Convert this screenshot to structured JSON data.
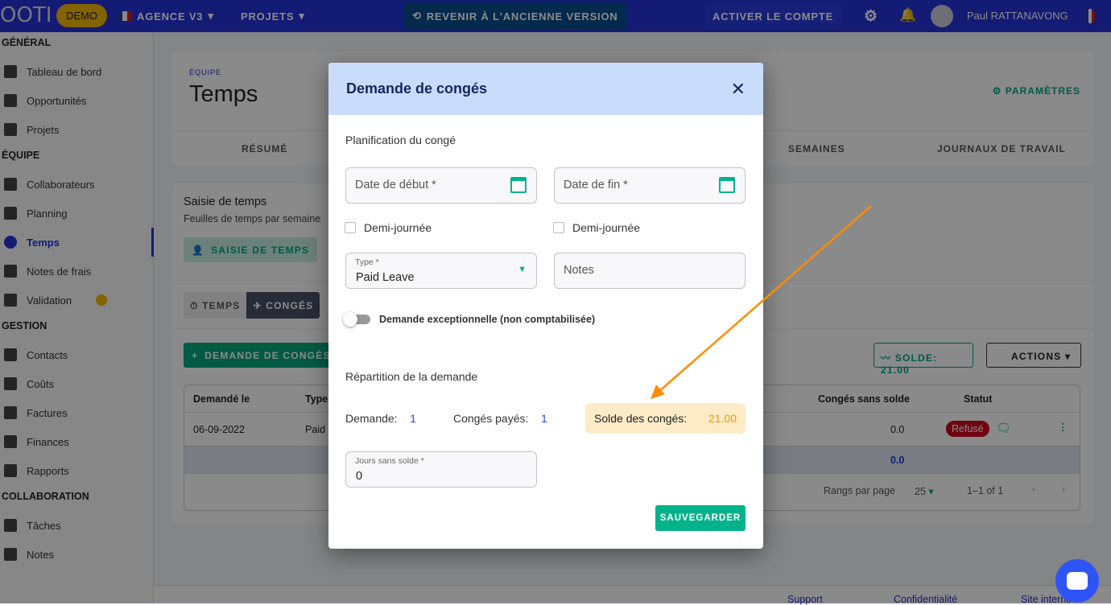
{
  "navbar": {
    "logo": "OOTI",
    "demo": "DEMO",
    "agency": "AGENCE V3",
    "projects": "PROJETS",
    "revert": "REVENIR À L'ANCIENNE VERSION",
    "activate": "ACTIVER LE COMPTE",
    "user": "Paul RATTANAVONG"
  },
  "sidebar": {
    "sections": [
      {
        "title": "GÉNÉRAL",
        "items": [
          {
            "label": "Tableau de bord",
            "icon": "dashboard-icon"
          },
          {
            "label": "Opportunités",
            "icon": "search-doc-icon"
          },
          {
            "label": "Projets",
            "icon": "document-icon"
          }
        ]
      },
      {
        "title": "ÉQUIPE",
        "items": [
          {
            "label": "Collaborateurs",
            "icon": "people-icon"
          },
          {
            "label": "Planning",
            "icon": "calendar-icon"
          },
          {
            "label": "Temps",
            "icon": "timer-icon",
            "active": true
          },
          {
            "label": "Notes de frais",
            "icon": "wallet-icon"
          },
          {
            "label": "Validation",
            "icon": "user-check-icon"
          }
        ]
      },
      {
        "title": "GESTION",
        "items": [
          {
            "label": "Contacts",
            "icon": "contacts-icon"
          },
          {
            "label": "Coûts",
            "icon": "trend-icon"
          },
          {
            "label": "Factures",
            "icon": "invoice-icon"
          },
          {
            "label": "Finances",
            "icon": "bank-icon"
          },
          {
            "label": "Rapports",
            "icon": "clipboard-icon"
          }
        ]
      },
      {
        "title": "COLLABORATION",
        "items": [
          {
            "label": "Tâches",
            "icon": "tasks-icon"
          },
          {
            "label": "Notes",
            "icon": "notes-icon"
          }
        ]
      }
    ]
  },
  "page": {
    "breadcrumb": "ÉQUIPE",
    "title": "Temps",
    "settings": "PARAMÈTRES",
    "tabs": [
      "RÉSUMÉ",
      "SEMAINES",
      "JOURNAUX DE TRAVAIL"
    ],
    "section_title": "Saisie de temps",
    "section_subtitle": "Feuilles de temps par semaine",
    "saisie_btn": "SAISIE DE TEMPS",
    "toggle": [
      "TEMPS",
      "CONGÉS"
    ],
    "request_btn": "DEMANDE DE CONGÉS",
    "balance_btn": "SOLDE: 21.00",
    "actions_btn": "ACTIONS",
    "table": {
      "headers": [
        "Demandé le",
        "Type",
        "Congés sans solde",
        "Statut"
      ],
      "row": {
        "date": "06-09-2022",
        "type": "Paid",
        "unpaid": "0.0",
        "status": "Refusé"
      },
      "total": "0.0",
      "footer": {
        "rows_label": "Rangs par page",
        "rows_value": "25",
        "range": "1–1 of 1"
      }
    },
    "footer_links": [
      "Support",
      "Confidentialité",
      "Site interne"
    ]
  },
  "modal": {
    "title": "Demande de congés",
    "planning": "Planification du congé",
    "start_date": "Date de début *",
    "end_date": "Date de fin *",
    "half_day": "Demi-journée",
    "type_label": "Type *",
    "type_value": "Paid Leave",
    "notes": "Notes",
    "exceptional": "Demande exceptionnelle (non comptabilisée)",
    "breakdown": "Répartition de la demande",
    "demand_label": "Demande:",
    "demand_value": "1",
    "paid_label": "Congés payés:",
    "paid_value": "1",
    "balance_label": "Solde des congés:",
    "balance_value": "21.00",
    "unpaid_label": "Jours sans solde *",
    "unpaid_value": "0",
    "save": "SAUVEGARDER"
  },
  "colors": {
    "navbar": "#2433d6",
    "accent": "#00b38a",
    "annotation": "#ff8c00",
    "refused": "#d0021b"
  }
}
